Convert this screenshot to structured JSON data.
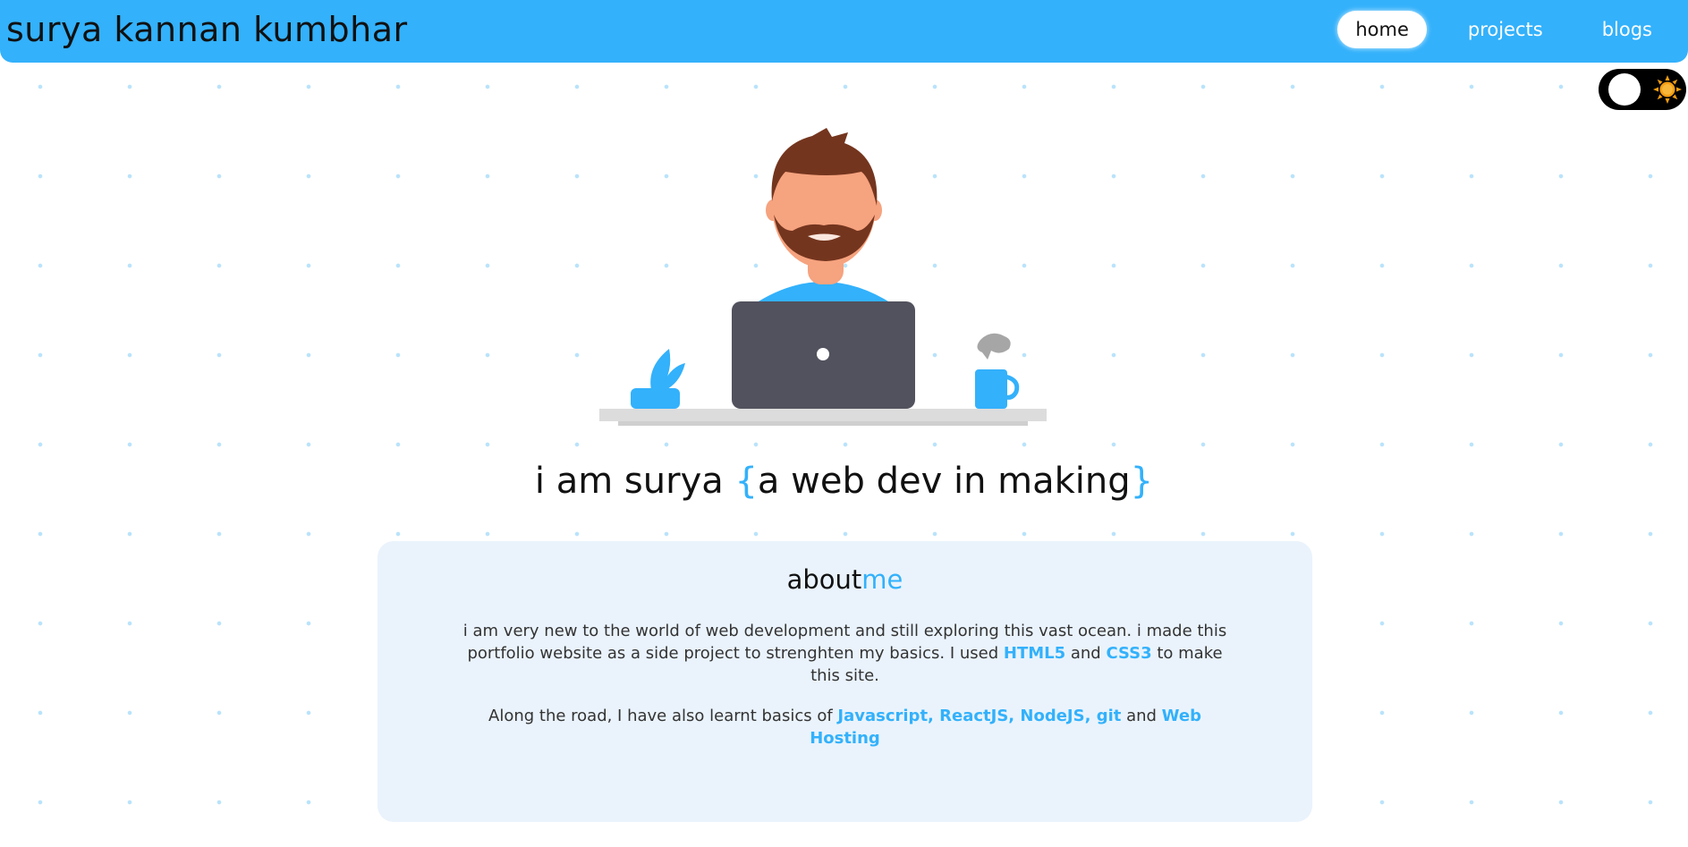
{
  "header": {
    "site_name": "surya kannan kumbhar",
    "nav": [
      {
        "label": "home",
        "active": true
      },
      {
        "label": "projects",
        "active": false
      },
      {
        "label": "blogs",
        "active": false
      }
    ]
  },
  "theme_toggle": {
    "icon": "sun-icon"
  },
  "hero": {
    "illustration": "developer-at-laptop-illustration",
    "headline_prefix": "i am surya ",
    "headline_open_brace": "{",
    "headline_tagline": "a web dev in making",
    "headline_close_brace": "}"
  },
  "about": {
    "title_main": "about",
    "title_accent": "me",
    "p1_a": "i am very new to the world of web development and still exploring this vast ocean. i made this portfolio website as a side project to strenghten my basics. I used ",
    "p1_html": "HTML5",
    "p1_and": " and ",
    "p1_css": "CSS3",
    "p1_b": " to make this site.",
    "p2_a": "Along the road, I have also learnt basics of ",
    "p2_skills": "Javascript, ReactJS, NodeJS, git",
    "p2_and": " and ",
    "p2_hosting": "Web Hosting"
  },
  "colors": {
    "accent": "#33b1fb",
    "card_bg": "#eaf3fc",
    "dot_pattern": "#b9e3fb"
  }
}
